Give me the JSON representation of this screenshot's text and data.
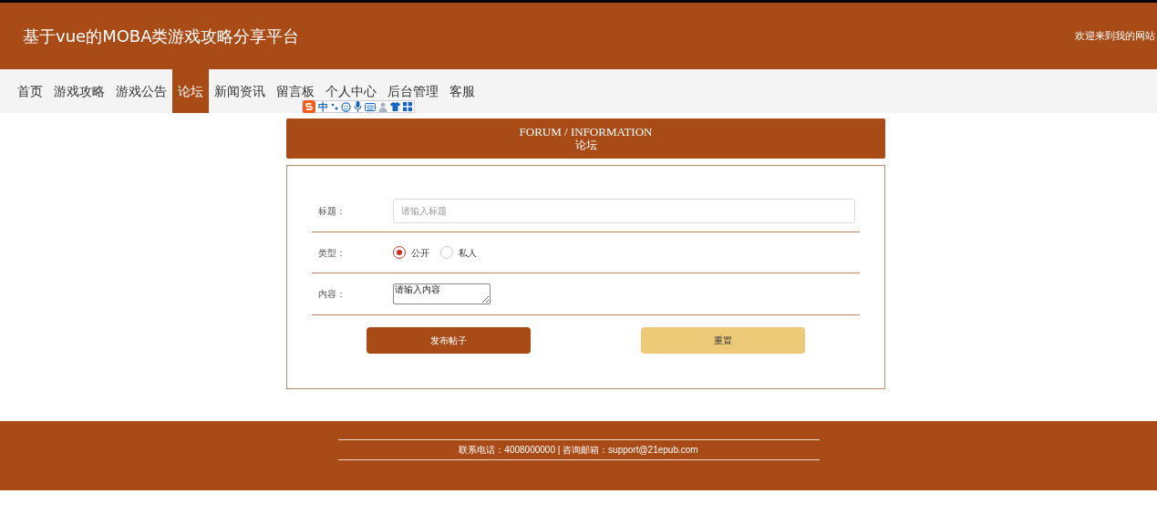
{
  "header": {
    "title": "基于vue的MOBA类游戏攻略分享平台",
    "welcome": "欢迎来到我的网站"
  },
  "nav": [
    {
      "label": "首页",
      "selected": false
    },
    {
      "label": "游戏攻略",
      "selected": false
    },
    {
      "label": "游戏公告",
      "selected": false
    },
    {
      "label": "论坛",
      "selected": true
    },
    {
      "label": "新闻资讯",
      "selected": false
    },
    {
      "label": "留言板",
      "selected": false
    },
    {
      "label": "个人中心",
      "selected": false
    },
    {
      "label": "后台管理",
      "selected": false
    },
    {
      "label": "客服",
      "selected": false
    }
  ],
  "ime_toolbar": {
    "mode": "中"
  },
  "section": {
    "title_en": "FORUM / INFORMATION",
    "title": "论坛"
  },
  "form": {
    "fields": [
      {
        "kind": "input",
        "label": "标题：",
        "placeholder": "请输入标题"
      },
      {
        "kind": "radio",
        "label": "类型：",
        "options": [
          {
            "label": "公开",
            "selected": true
          },
          {
            "label": "私人",
            "selected": false
          }
        ]
      },
      {
        "kind": "textarea",
        "label": "内容：",
        "placeholder": "请输入内容"
      }
    ],
    "buttons": [
      {
        "kind": "primary",
        "label": "发布帖子"
      },
      {
        "kind": "secondary",
        "label": "重置"
      }
    ]
  },
  "footer": {
    "contact": "联系电话：4008000000 | 咨询邮箱：support@21epub.com"
  }
}
